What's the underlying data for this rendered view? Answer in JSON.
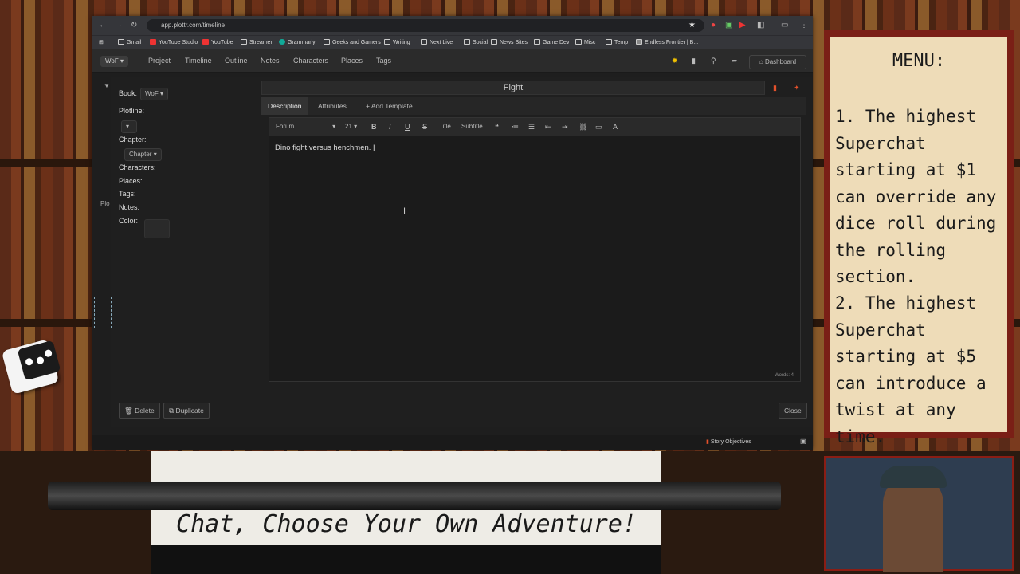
{
  "browser": {
    "url": "app.plottr.com/timeline",
    "bookmarks": [
      "Gmail",
      "YouTube Studio",
      "YouTube",
      "Streamer",
      "Grammarly",
      "Geeks and Gamers",
      "Writing",
      "Next Live",
      "Social",
      "News Sites",
      "Game Dev",
      "Misc",
      "Temp",
      "Endless Frontier | B..."
    ]
  },
  "app": {
    "book_selector": "WoF",
    "nav": [
      "Project",
      "Timeline",
      "Outline",
      "Notes",
      "Characters",
      "Places",
      "Tags"
    ],
    "dashboard_label": "Dashboard",
    "side_label": "Plo"
  },
  "modal": {
    "book_label": "Book:",
    "book_value": "WoF",
    "plotline_label": "Plotline:",
    "plotline_value": "",
    "chapter_label": "Chapter:",
    "chapter_value": "Chapter",
    "characters_label": "Characters:",
    "places_label": "Places:",
    "tags_label": "Tags:",
    "notes_label": "Notes:",
    "color_label": "Color:",
    "title": "Fight",
    "tabs": [
      "Description",
      "Attributes",
      "+ Add Template"
    ],
    "toolbar": {
      "font": "Forum",
      "size": "21",
      "title_btn": "Title",
      "subtitle_btn": "Subtitle"
    },
    "content": "Dino fight versus henchmen.",
    "word_count": "Words: 4",
    "delete_label": "Delete",
    "duplicate_label": "Duplicate",
    "close_label": "Close"
  },
  "bottom_bar": {
    "story_objectives": "Story Objectives"
  },
  "overlay_menu": {
    "title": "MENU:",
    "item1": "1. The highest Superchat starting at $1 can override any dice roll during the rolling section.",
    "item2": "2. The highest Superchat starting at $5 can introduce a twist at any time."
  },
  "typewriter_text": "Chat, Choose Your Own Adventure!"
}
